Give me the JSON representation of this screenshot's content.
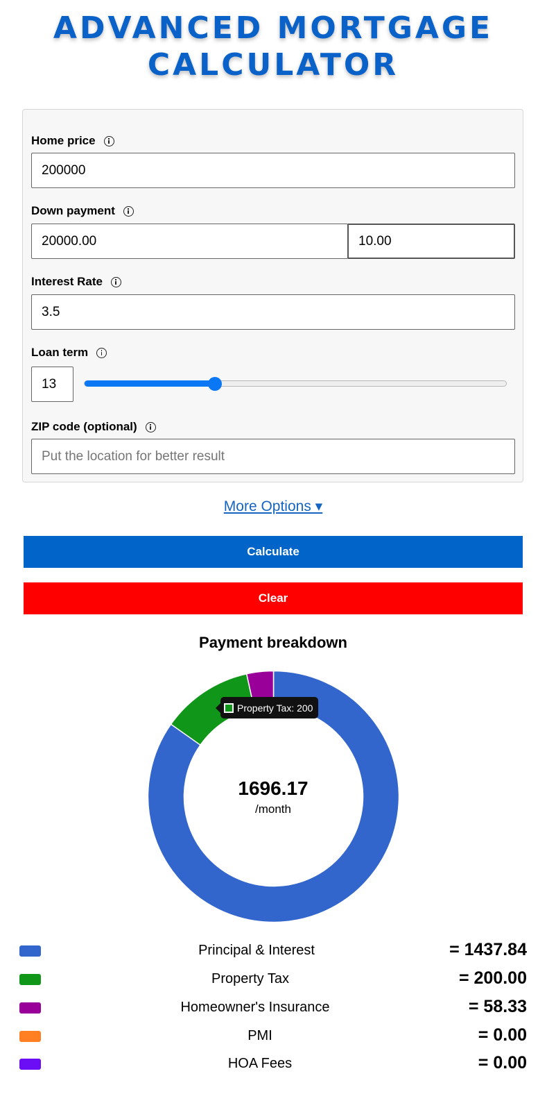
{
  "title": "ADVANCED MORTGAGE CALCULATOR",
  "form": {
    "home_price": {
      "label": "Home price",
      "value": "200000"
    },
    "down_payment": {
      "label": "Down payment",
      "amount": "20000.00",
      "percent": "10.00"
    },
    "interest_rate": {
      "label": "Interest Rate",
      "value": "3.5"
    },
    "loan_term": {
      "label": "Loan term",
      "value": "13",
      "slider_min": 1,
      "slider_max": 40,
      "slider_value": 13
    },
    "zip": {
      "label": "ZIP code (optional)",
      "placeholder": "Put the location for better result",
      "value": ""
    }
  },
  "more_options": "More Options ▾",
  "buttons": {
    "calculate": "Calculate",
    "clear": "Clear"
  },
  "colors": {
    "title": "#0a62c9",
    "calculate_bg": "#0064c8",
    "clear_bg": "#ff0000",
    "accent": "#0a78f5"
  },
  "breakdown": {
    "title": "Payment breakdown",
    "total": "1696.17",
    "unit": "/month",
    "tooltip": "Property Tax: 200",
    "tooltip_color": "#109618"
  },
  "chart_data": {
    "type": "pie",
    "title": "Payment breakdown",
    "categories": [
      "Principal & Interest",
      "Property Tax",
      "Homeowner's Insurance",
      "PMI",
      "HOA Fees"
    ],
    "values": [
      1437.84,
      200.0,
      58.33,
      0.0,
      0.0
    ],
    "colors": [
      "#3366cc",
      "#109618",
      "#990099",
      "#ff7f22",
      "#6b0ef5"
    ]
  },
  "legend": [
    {
      "label": "Principal & Interest",
      "value": "= 1437.84",
      "color": "#3366cc"
    },
    {
      "label": "Property Tax",
      "value": "= 200.00",
      "color": "#109618"
    },
    {
      "label": "Homeowner's Insurance",
      "value": "= 58.33",
      "color": "#990099"
    },
    {
      "label": "PMI",
      "value": "= 0.00",
      "color": "#ff7f22"
    },
    {
      "label": "HOA Fees",
      "value": "= 0.00",
      "color": "#6b0ef5"
    }
  ]
}
